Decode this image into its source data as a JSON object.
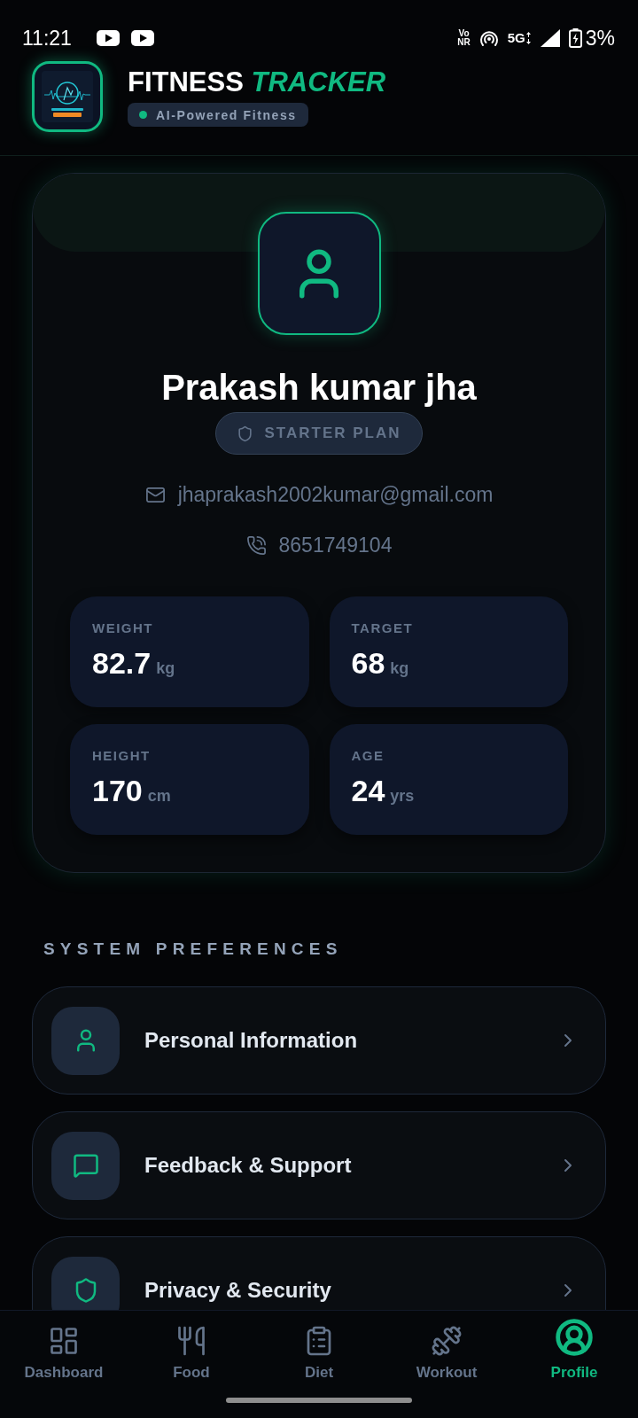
{
  "status_bar": {
    "time": "11:21",
    "voice_top": "Vo",
    "voice_bottom": "NR",
    "network_type": "5G",
    "battery": "3%"
  },
  "header": {
    "title": "FITNESS",
    "title_accent": "TRACKER",
    "badge": "AI-Powered Fitness"
  },
  "profile": {
    "name": "Prakash kumar jha",
    "plan": "STARTER PLAN",
    "email": "jhaprakash2002kumar@gmail.com",
    "phone": "8651749104",
    "stats": [
      {
        "label": "WEIGHT",
        "value": "82.7",
        "unit": "kg"
      },
      {
        "label": "TARGET",
        "value": "68",
        "unit": "kg"
      },
      {
        "label": "HEIGHT",
        "value": "170",
        "unit": "cm"
      },
      {
        "label": "AGE",
        "value": "24",
        "unit": "yrs"
      }
    ]
  },
  "preferences": {
    "title": "SYSTEM PREFERENCES",
    "items": [
      {
        "kind": "person",
        "label": "Personal Information"
      },
      {
        "kind": "message",
        "label": "Feedback & Support"
      },
      {
        "kind": "shield",
        "label": "Privacy & Security"
      }
    ]
  },
  "bottom_nav": [
    {
      "kind": "dashboard",
      "label": "Dashboard",
      "selected": false
    },
    {
      "kind": "food",
      "label": "Food",
      "selected": false
    },
    {
      "kind": "diet",
      "label": "Diet",
      "selected": false
    },
    {
      "kind": "workout",
      "label": "Workout",
      "selected": false
    },
    {
      "kind": "profile",
      "label": "Profile",
      "selected": true
    }
  ]
}
